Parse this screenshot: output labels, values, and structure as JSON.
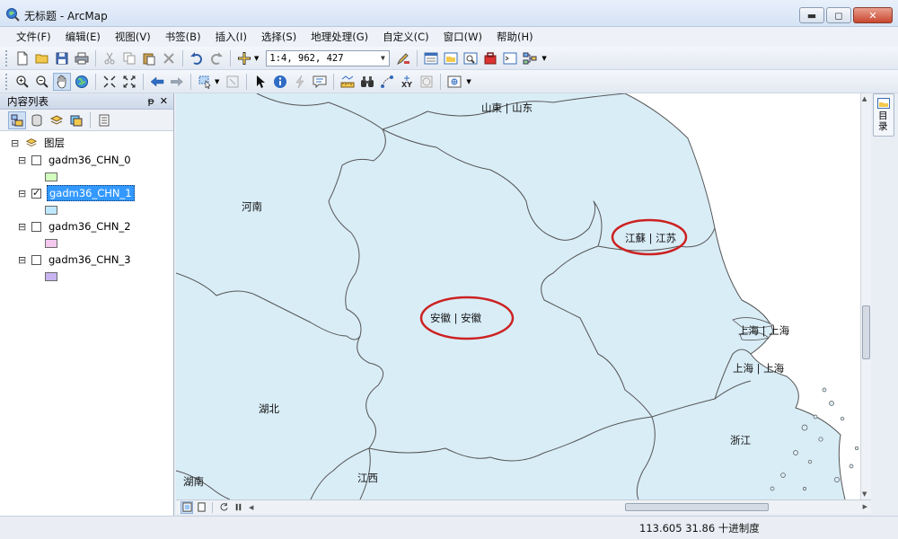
{
  "window": {
    "title": "无标题 - ArcMap",
    "minimize_glyph": "▬",
    "maximize_glyph": "◻",
    "close_glyph": "✕"
  },
  "menu": [
    {
      "label": "文件(F)"
    },
    {
      "label": "编辑(E)"
    },
    {
      "label": "视图(V)"
    },
    {
      "label": "书签(B)"
    },
    {
      "label": "插入(I)"
    },
    {
      "label": "选择(S)"
    },
    {
      "label": "地理处理(G)"
    },
    {
      "label": "自定义(C)"
    },
    {
      "label": "窗口(W)"
    },
    {
      "label": "帮助(H)"
    }
  ],
  "toolbar": {
    "scale_value": "1:4, 962, 427",
    "dropdown_glyph": "▼"
  },
  "toc": {
    "title": "内容列表",
    "pin_glyph": "ᵽ",
    "close_glyph": "✕",
    "root_label": "图层",
    "layers": [
      {
        "name": "gadm36_CHN_0",
        "checked": false,
        "selected": false,
        "color": "#d3ffbe"
      },
      {
        "name": "gadm36_CHN_1",
        "checked": true,
        "selected": true,
        "color": "#bee8ff"
      },
      {
        "name": "gadm36_CHN_2",
        "checked": false,
        "selected": false,
        "color": "#f5c8f0"
      },
      {
        "name": "gadm36_CHN_3",
        "checked": false,
        "selected": false,
        "color": "#c8b4f0"
      }
    ],
    "expander_glyph": "⊟"
  },
  "map": {
    "fill_color": "#d9edf7",
    "annotation_color": "#cc2222",
    "labels": {
      "shandong": "山東 | 山东",
      "henan": "河南",
      "jiangsu": "江蘇 | 江苏",
      "anhui": "安徽 | 安徽",
      "shanghai_1": "上海 | 上海",
      "shanghai_2": "上海 | 上海",
      "hubei": "湖北",
      "zhejiang": "浙江",
      "jiangxi": "江西",
      "hunan": "湖南"
    }
  },
  "side_tab": {
    "label": "目录"
  },
  "status": {
    "coords": "113.605  31.86 十进制度"
  }
}
